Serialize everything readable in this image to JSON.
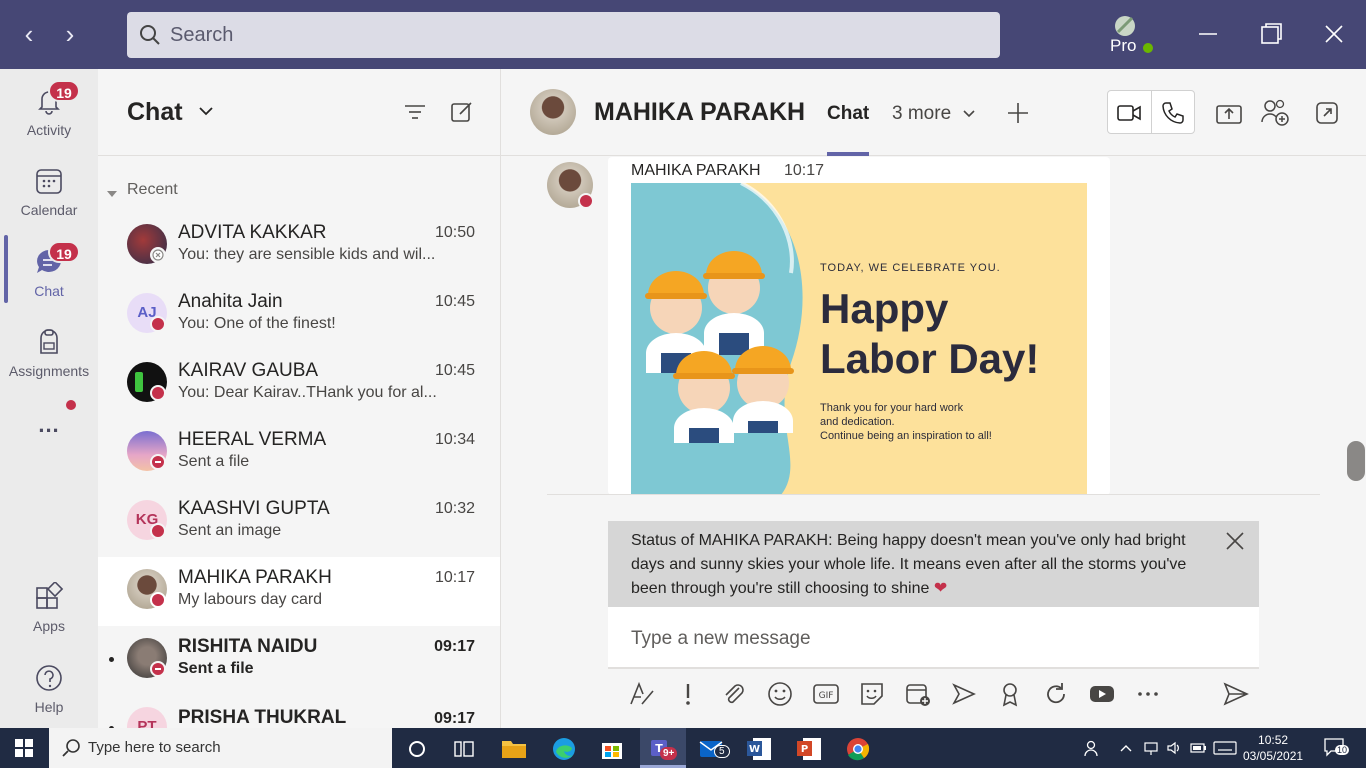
{
  "search": {
    "placeholder": "Search"
  },
  "profile": {
    "label": "Pro"
  },
  "rail": {
    "items": [
      {
        "label": "Activity",
        "badge": "19"
      },
      {
        "label": "Calendar"
      },
      {
        "label": "Chat",
        "badge": "19"
      },
      {
        "label": "Assignments"
      },
      {
        "label": "..."
      },
      {
        "label": "Apps"
      },
      {
        "label": "Help"
      }
    ]
  },
  "chatlist": {
    "title": "Chat",
    "section": "Recent",
    "rows": [
      {
        "name": "ADVITA KAKKAR",
        "time": "10:50",
        "preview": "You: they are sensible kids and wil..."
      },
      {
        "name": "Anahita Jain",
        "time": "10:45",
        "preview": "You: One of the finest!",
        "initials": "AJ"
      },
      {
        "name": "KAIRAV GAUBA",
        "time": "10:45",
        "preview": "You: Dear Kairav..THank you for al..."
      },
      {
        "name": "HEERAL VERMA",
        "time": "10:34",
        "preview": "Sent a file"
      },
      {
        "name": "KAASHVI GUPTA",
        "time": "10:32",
        "preview": "Sent an image",
        "initials": "KG"
      },
      {
        "name": "MAHIKA PARAKH",
        "time": "10:17",
        "preview": "My labours day card"
      },
      {
        "name": "RISHITA NAIDU",
        "time": "09:17",
        "preview": "Sent a file"
      },
      {
        "name": "PRISHA THUKRAL",
        "time": "09:17",
        "initials": "PT"
      }
    ]
  },
  "conversation": {
    "name": "MAHIKA PARAKH",
    "tab_chat": "Chat",
    "tab_more": "3 more",
    "message": {
      "sender": "MAHIKA PARAKH",
      "time": "10:17",
      "card": {
        "kicker": "TODAY, WE CELEBRATE YOU.",
        "headline1": "Happy",
        "headline2": "Labor Day!",
        "body1": "Thank you for your hard work",
        "body2": "and dedication.",
        "body3": "Continue being an inspiration to all!"
      }
    },
    "status_banner": "Status of MAHIKA PARAKH: Being happy doesn't mean you've only had bright days and sunny skies your whole life. It means even after all the storms you've been through you're still choosing to shine",
    "compose_placeholder": "Type a new message"
  },
  "taskbar": {
    "search_placeholder": "Type here to search",
    "teams_badge": "9+",
    "mail_badge": "5",
    "time": "10:52",
    "date": "03/05/2021",
    "notif_count": "10"
  },
  "colors": {
    "accent": "#6264a7",
    "titlebar": "#464775",
    "badge": "#c4314b"
  }
}
